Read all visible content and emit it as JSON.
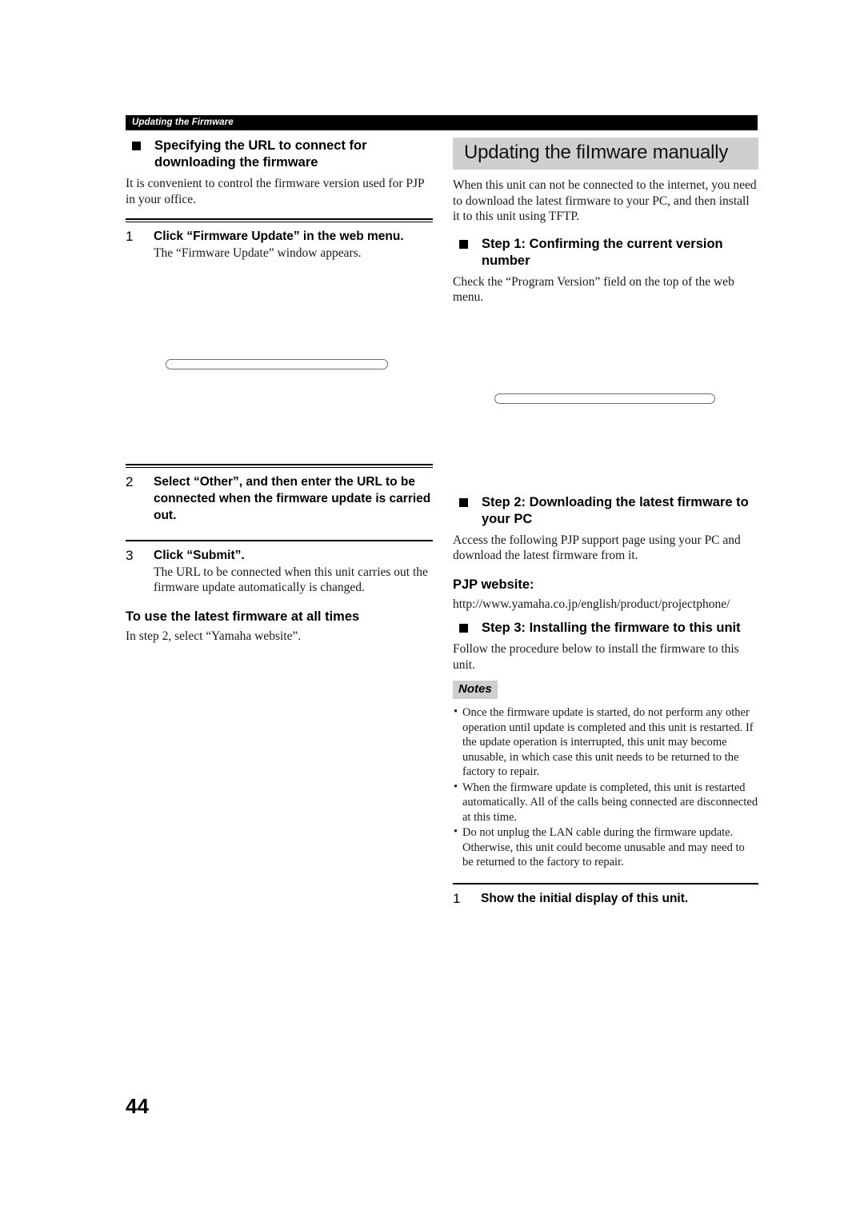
{
  "running_header": {
    "text": "Updating the Firmware"
  },
  "page_number": "44",
  "left_column": {
    "heading": "Specifying the URL to connect for downloading the firmware",
    "intro": "It is convenient to control the firmware version used for PJP in your office.",
    "steps": [
      {
        "number": "1",
        "title": "Click “Firmware Update” in the web menu.",
        "description": "The “Firmware Update” window appears."
      },
      {
        "number": "2",
        "title": "Select “Other”, and then enter the URL to be connected when the firmware update is carried out.",
        "description": ""
      },
      {
        "number": "3",
        "title": "Click “Submit”.",
        "description": "The URL to be connected when this unit carries out the firmware update automatically is changed."
      }
    ],
    "tip_heading": "To use the latest firmware at all times",
    "tip_text": "In step 2, select “Yamaha website”."
  },
  "right_column": {
    "title": "Updating the fiImware manually",
    "intro": "When this unit can not be connected to the internet, you need to download the latest firmware to your PC, and then install it to this unit using TFTP.",
    "step1_heading": "Step 1: Confirming the current version number",
    "step1_text": "Check the “Program Version” field on the top of the web menu.",
    "step2_heading": "Step 2: Downloading the latest firmware to your PC",
    "step2_text": "Access the following PJP support page using your PC and download the latest firmware from it.",
    "website_label": "PJP website:",
    "website_url": "http://www.yamaha.co.jp/english/product/projectphone/",
    "step3_heading": "Step 3: Installing the firmware to this unit",
    "step3_text": "Follow the procedure below to install the firmware to this unit.",
    "notes_label": "Notes",
    "notes": [
      "Once the firmware update is started, do not perform any other operation until update is completed and this unit is restarted. If the update operation is interrupted, this unit may become unusable, in which case this unit needs to be returned to the factory to repair.",
      "When the firmware update is completed, this unit is restarted automatically. All of the calls being connected are disconnected at this time.",
      "Do not unplug the LAN cable during the firmware update. Otherwise, this unit could become unusable and may need to be returned to the factory to repair."
    ],
    "final_step": {
      "number": "1",
      "title": "Show the initial display of this unit."
    }
  }
}
